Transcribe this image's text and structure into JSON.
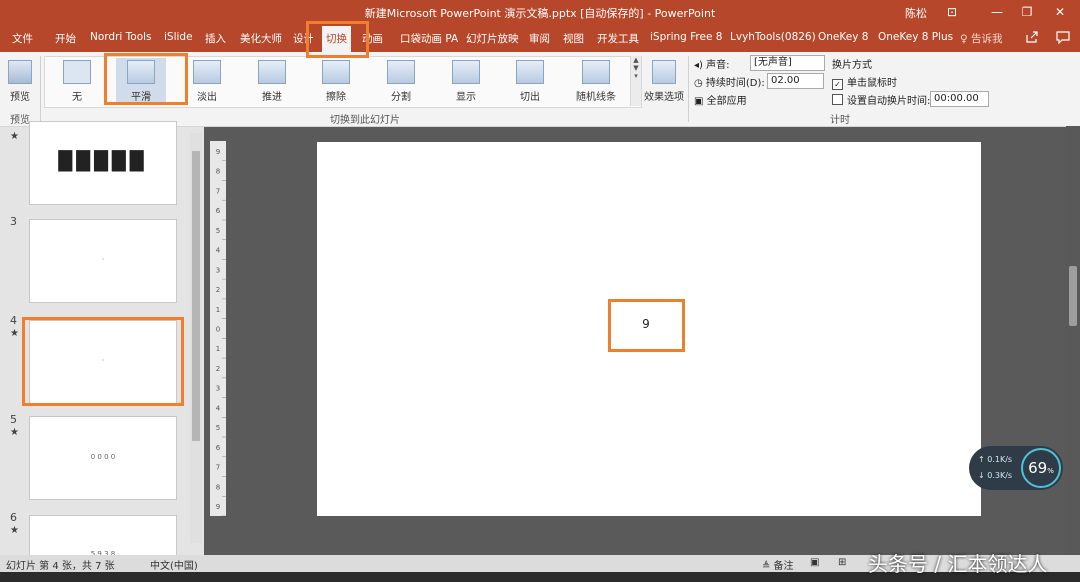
{
  "window": {
    "title": "新建Microsoft PowerPoint 演示文稿.pptx [自动保存的]  -  PowerPoint",
    "user": "陈松",
    "controls": {
      "ribbon_options": "⊡",
      "minimize": "—",
      "restore": "❐",
      "close": "✕"
    }
  },
  "menu": {
    "tabs": [
      "文件",
      "开始",
      "Nordri Tools",
      "iSlide",
      "插入",
      "美化大师",
      "设计",
      "切换",
      "动画",
      "口袋动画 PA",
      "幻灯片放映",
      "审阅",
      "视图",
      "开发工具",
      "iSpring Free 8",
      "LvyhTools(0826)",
      "OneKey 8",
      "OneKey 8 Plus"
    ],
    "active_tab": "切换",
    "tell_me": "♀ 告诉我",
    "share_icon": "share-icon",
    "comment_icon": "comment-icon"
  },
  "ribbon": {
    "preview": {
      "label": "预览",
      "group_label": "预览"
    },
    "transitions": {
      "items": [
        "无",
        "平滑",
        "淡出",
        "推进",
        "擦除",
        "分割",
        "显示",
        "切出",
        "随机线条"
      ],
      "selected": "平滑",
      "group_label": "切换到此幻灯片",
      "effect_options": "效果选项"
    },
    "timing": {
      "sound_label": "声音:",
      "sound_value": "[无声音]",
      "duration_label": "持续时间(D):",
      "duration_value": "02.00",
      "apply_all": "全部应用",
      "advance_header": "换片方式",
      "on_click": "单击鼠标时",
      "on_click_checked": true,
      "after_label": "设置自动换片时间:",
      "after_value": "00:00.00",
      "group_label": "计时"
    }
  },
  "slides_panel": {
    "slides": [
      {
        "num": "",
        "star": "★",
        "content": "█████"
      },
      {
        "num": "3",
        "star": "",
        "content": "·"
      },
      {
        "num": "4",
        "star": "★",
        "content": "·"
      },
      {
        "num": "5",
        "star": "★",
        "content": "0  0  0  0"
      },
      {
        "num": "6",
        "star": "★",
        "content": "5  9  3  8"
      }
    ],
    "selected_slide": "4"
  },
  "ruler": {
    "labels": [
      "9",
      "8",
      "7",
      "6",
      "5",
      "4",
      "3",
      "2",
      "1",
      "0",
      "1",
      "2",
      "3",
      "4",
      "5",
      "6",
      "7",
      "8",
      "9"
    ]
  },
  "slide": {
    "text": "9"
  },
  "statusbar": {
    "slide_info": "幻灯片 第 4 张，共 7 张",
    "language": "中文(中国)",
    "notes": "≜ 备注"
  },
  "netwidget": {
    "up": "↑ 0.1K/s",
    "down": "↓ 0.3K/s",
    "percent": "69",
    "percent_unit": "%"
  },
  "watermark": "头条号 / 汇本领达人",
  "colors": {
    "accent": "#b7472a",
    "highlight": "#ef7f2f"
  }
}
